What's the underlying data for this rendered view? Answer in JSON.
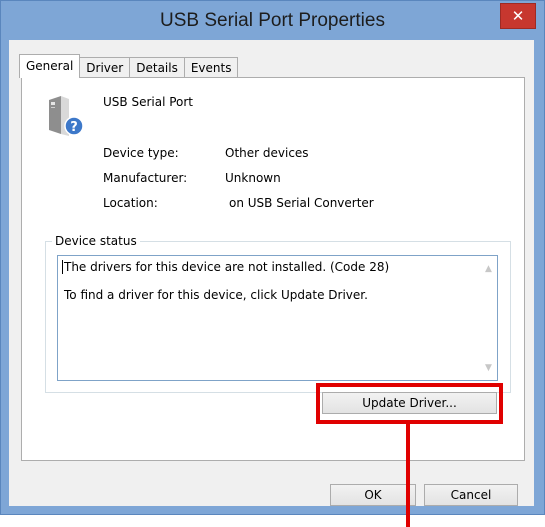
{
  "window": {
    "title": "USB Serial Port Properties"
  },
  "tabs": [
    {
      "label": "General"
    },
    {
      "label": "Driver"
    },
    {
      "label": "Details"
    },
    {
      "label": "Events"
    }
  ],
  "device": {
    "name": "USB Serial Port",
    "properties": [
      {
        "label": "Device type:",
        "value": "Other devices"
      },
      {
        "label": "Manufacturer:",
        "value": "Unknown"
      },
      {
        "label": "Location:",
        "value": "on USB Serial Converter"
      }
    ]
  },
  "status": {
    "legend": "Device status",
    "line1": "The drivers for this device are not installed. (Code 28)",
    "line2": "To find a driver for this device, click Update Driver."
  },
  "buttons": {
    "update_driver": "Update Driver...",
    "ok": "OK",
    "cancel": "Cancel"
  },
  "icons": {
    "close": "close-icon",
    "device": "unknown-device-icon"
  },
  "colors": {
    "frame": "#7ea6d6",
    "close_button": "#c7372f",
    "highlight": "#e00000"
  }
}
